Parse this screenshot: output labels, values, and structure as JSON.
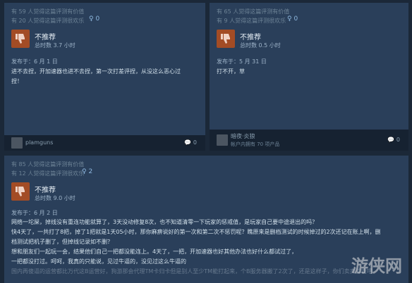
{
  "reviews": [
    {
      "helpful": "有 59 人觉得这篇评测有价值",
      "funny": "有 20 人觉得这篇评测很欢乐",
      "awards": "0",
      "verdict": "不推荐",
      "hours": "总时数 3.7 小时",
      "posted": "发布于：6 月 1 日",
      "text": [
        "进不去捏，开加速器也进不去捏，第一次打差评捏，从没这么恶心过",
        "捏！"
      ],
      "user": "plamguns",
      "user_info": "",
      "comments": "0"
    },
    {
      "helpful": "有 65 人觉得这篇评测有价值",
      "funny": "有 9 人觉得这篇评测很欢乐",
      "awards": "0",
      "verdict": "不推荐",
      "hours": "总时数 0.5 小时",
      "posted": "发布于：5 月 31 日",
      "text": [
        "打不开，草"
      ],
      "user": "暗夜·炎狼",
      "user_info": "帐户内拥有 70 项产品",
      "comments": "0"
    },
    {
      "helpful": "有 85 人觉得这篇评测有价值",
      "funny": "有 12 人觉得这篇评测很欢乐",
      "awards": "2",
      "verdict": "不推荐",
      "hours": "总时数 9.0 小时",
      "posted": "发布于：6 月 2 日",
      "text": [
        "网络一坨屎，掉线没有重连功能就算了，3天没动修复8次，也不知道清零一下玩家的惩戒值，是玩家自己要中途退出的吗？",
        "快4天了，一共打了8把，掉了1把就是1天05小时，那你麻痹说好的第一次和第二次不惩罚呢？瞧原来是删档测试的时候掉过的2次还记在账上啊，删",
        "档测试把机子删了，但掉线记录如不删？",
        "想和朋友们一起玩一会，结果他们自己一把都没能连上。4天了，一把，开加速器也好其他办法也好什么都试过了，",
        "一把都没打过。呵呵，我真的只能说，见过牛逼的，没见过这么牛逼的",
        "国内再傻逼的运营都比万代这B运营好，狗游那会代理TM卡归卡但是别人至少TM能打起来，个B服务器搬了2次了，还是这样子，你们卖卖游戏吧"
      ]
    }
  ],
  "watermark": "游侠网"
}
